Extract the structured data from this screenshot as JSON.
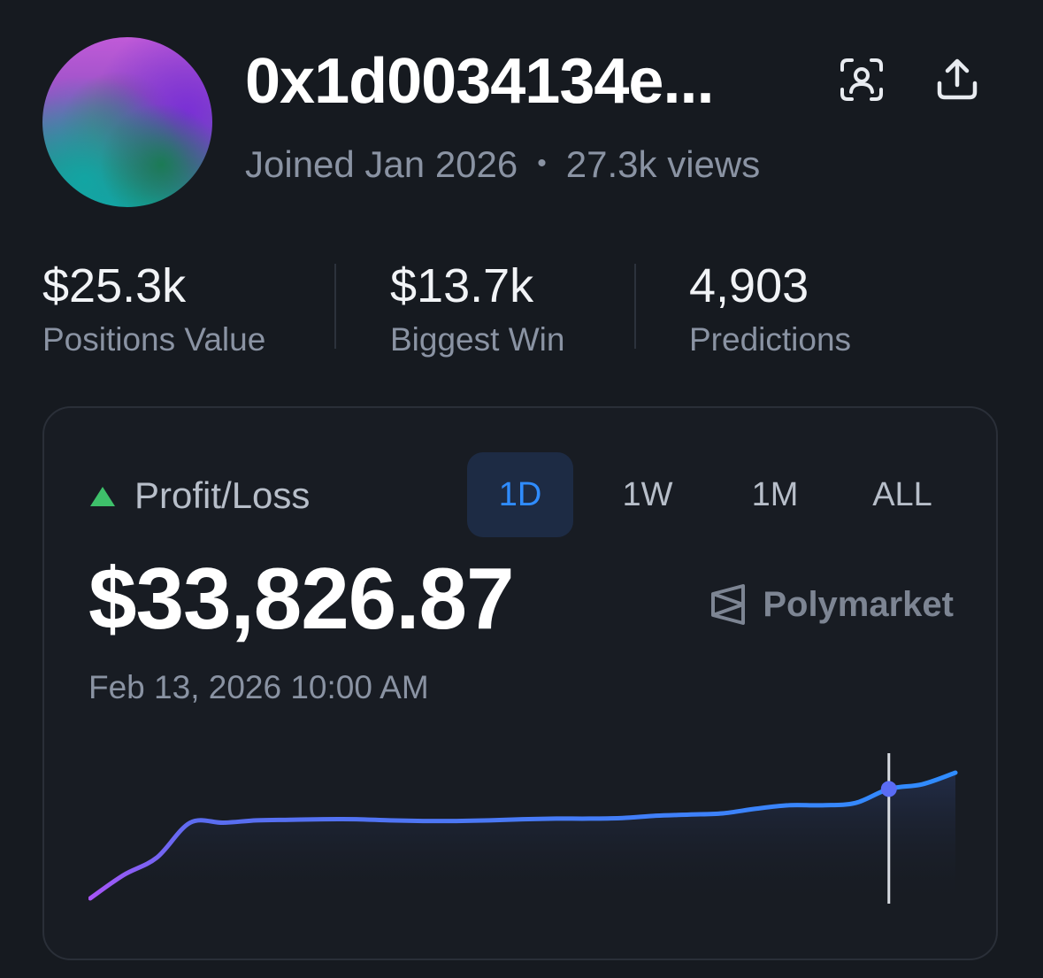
{
  "profile": {
    "username": "0x1d0034134e...",
    "joined": "Joined Jan 2026",
    "separator": "•",
    "views": "27.3k views"
  },
  "stats": [
    {
      "value": "$25.3k",
      "label": "Positions Value"
    },
    {
      "value": "$13.7k",
      "label": "Biggest Win"
    },
    {
      "value": "4,903",
      "label": "Predictions"
    }
  ],
  "pnl": {
    "title": "Profit/Loss",
    "value": "$33,826.87",
    "timestamp": "Feb 13, 2026 10:00 AM",
    "brand": "Polymarket",
    "tabs": [
      "1D",
      "1W",
      "1M",
      "ALL"
    ],
    "active_tab": "1D"
  },
  "icons": {
    "scan": "face-scan-icon",
    "share": "share-upload-icon",
    "trend": "triangle-up-icon",
    "brand": "polymarket-logo-icon"
  },
  "colors": {
    "accent": "#2f8cff",
    "positive": "#3ec06a",
    "line_start": "#a855f7",
    "line_end": "#2f8cff"
  },
  "chart_data": {
    "type": "line",
    "x": [
      0,
      1,
      2,
      3,
      4,
      5,
      6,
      7,
      8,
      9,
      10,
      11,
      12,
      13,
      14,
      15,
      16,
      17,
      18,
      19,
      20,
      21,
      22,
      23,
      24,
      25,
      26
    ],
    "values": [
      0,
      20,
      35,
      65,
      65,
      67,
      67.5,
      68,
      68,
      67,
      66.5,
      66.5,
      67,
      68,
      68.5,
      68.5,
      69,
      71,
      72,
      73,
      77,
      80,
      80,
      82,
      94,
      98,
      108
    ],
    "hover_index": 24
  }
}
